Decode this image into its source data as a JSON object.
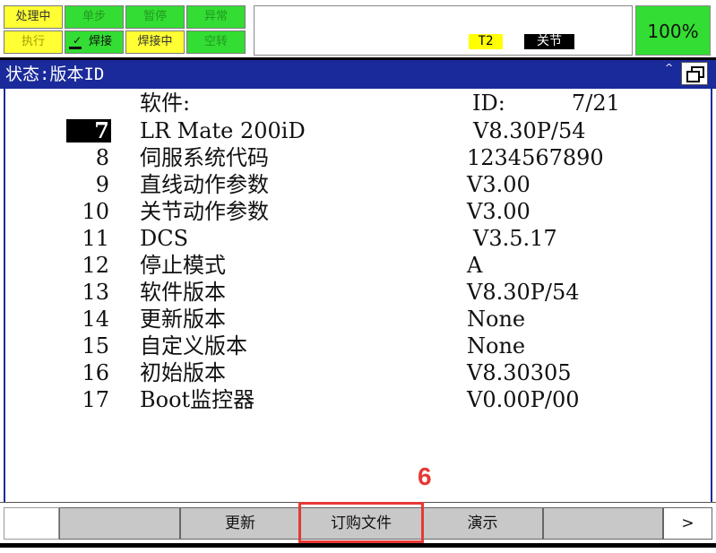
{
  "status": {
    "row1": [
      "处理中",
      "单步",
      "暂停",
      "异常"
    ],
    "row2": [
      "执行",
      "焊接",
      "焊接中",
      "空转"
    ],
    "mode": "T2",
    "coord": "关节",
    "override": "100%"
  },
  "titlebar": {
    "title": "状态:版本ID",
    "caret": "^"
  },
  "header": {
    "software_label": "软件:",
    "id_label": "ID:",
    "page": "7/21"
  },
  "rows": [
    {
      "num": "7",
      "name": "LR Mate 200iD",
      "value": "V8.30P/54"
    },
    {
      "num": "8",
      "name": "伺服系统代码",
      "value": "1234567890"
    },
    {
      "num": "9",
      "name": "直线动作参数",
      "value": "V3.00"
    },
    {
      "num": "10",
      "name": "关节动作参数",
      "value": "V3.00"
    },
    {
      "num": "11",
      "name": "DCS",
      "value": "V3.5.17"
    },
    {
      "num": "12",
      "name": "停止模式",
      "value": "A"
    },
    {
      "num": "13",
      "name": "软件版本",
      "value": "V8.30P/54"
    },
    {
      "num": "14",
      "name": "更新版本",
      "value": "None"
    },
    {
      "num": "15",
      "name": "自定义版本",
      "value": "None"
    },
    {
      "num": "16",
      "name": "初始版本",
      "value": "V8.30305"
    },
    {
      "num": "17",
      "name": "Boot监控器",
      "value": "V0.00P/00"
    }
  ],
  "fkeys": {
    "f2": "更新",
    "f3": "订购文件",
    "f4": "演示",
    "next": ">"
  },
  "annotation": {
    "step": "6"
  },
  "colors": {
    "titlebar": "#1a2a9a",
    "highlight": "#e53935",
    "status_yellow": "#ffff33",
    "status_green": "#33dd33"
  }
}
